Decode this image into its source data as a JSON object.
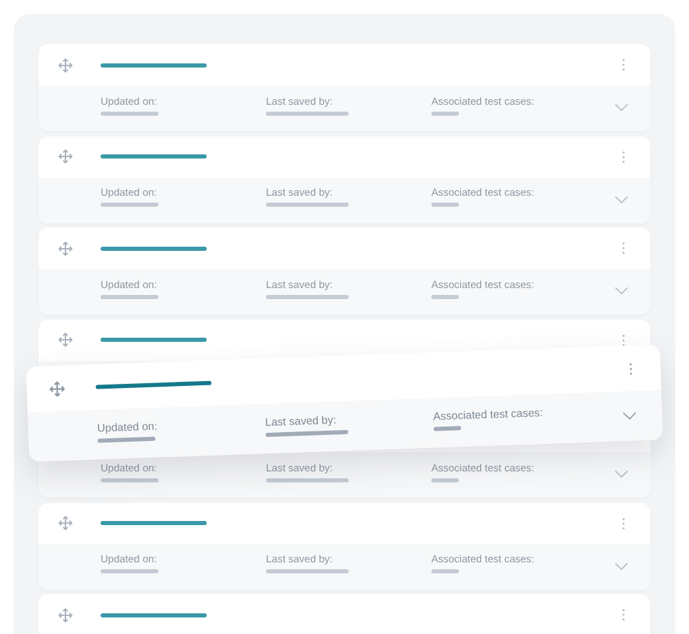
{
  "cards": [
    {
      "kind": "full",
      "footer": [
        "Updated on:",
        "Last saved by:",
        "Associated test cases:"
      ]
    },
    {
      "kind": "full",
      "footer": [
        "Updated on:",
        "Last saved by:",
        "Associated test cases:"
      ]
    },
    {
      "kind": "full",
      "footer": [
        "Updated on:",
        "Last saved by:",
        "Associated test cases:"
      ]
    },
    {
      "kind": "header_only"
    },
    {
      "kind": "footer_only",
      "footer": [
        "Updated on:",
        "Last saved by:",
        "Associated test cases:"
      ]
    },
    {
      "kind": "full",
      "footer": [
        "Updated on:",
        "Last saved by:",
        "Associated test cases:"
      ]
    },
    {
      "kind": "header_only"
    }
  ],
  "dragged_card": {
    "footer": [
      "Updated on:",
      "Last saved by:",
      "Associated test cases:"
    ]
  }
}
